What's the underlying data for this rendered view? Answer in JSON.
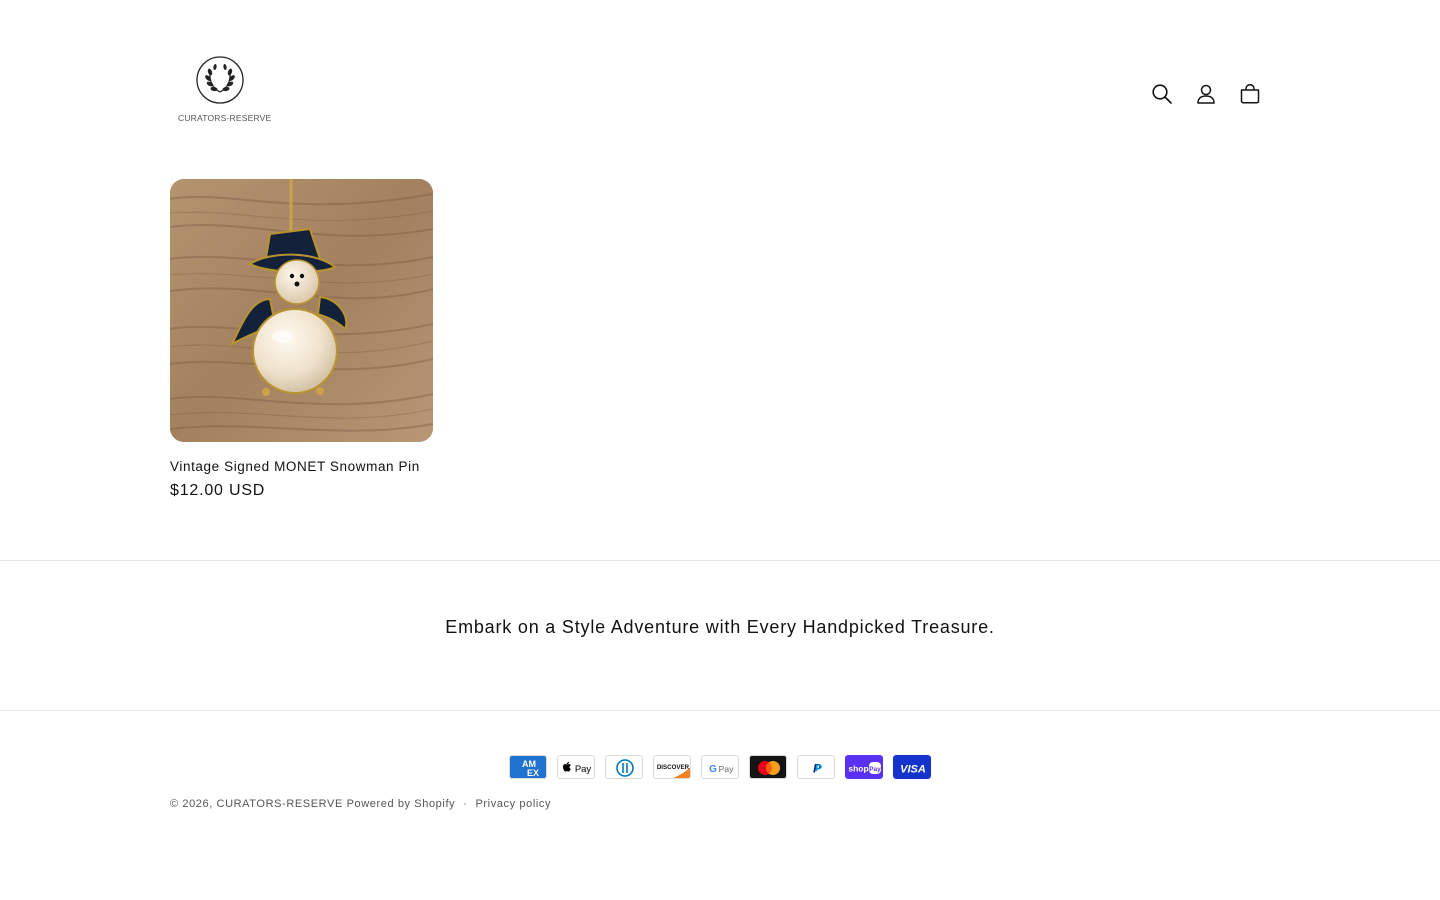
{
  "header": {
    "logo_text": "CURATORS-RESERVE",
    "icons": [
      "search-icon",
      "account-icon",
      "cart-icon"
    ]
  },
  "products": [
    {
      "title": "Vintage Signed MONET Snowman Pin",
      "price": "$12.00 USD"
    }
  ],
  "footer": {
    "tagline": "Embark on a Style Adventure with Every Handpicked Treasure.",
    "payment_methods": [
      "American Express",
      "Apple Pay",
      "Diners Club",
      "Discover",
      "Google Pay",
      "Mastercard",
      "PayPal",
      "Shop Pay",
      "Visa"
    ],
    "copyright_prefix": "© 2026,",
    "store_name": "CURATORS-RESERVE",
    "powered_by": "Powered by Shopify",
    "privacy_policy": "Privacy policy"
  },
  "colors": {
    "text": "#121212",
    "muted": "#555555",
    "divider": "#e6e6e6"
  }
}
